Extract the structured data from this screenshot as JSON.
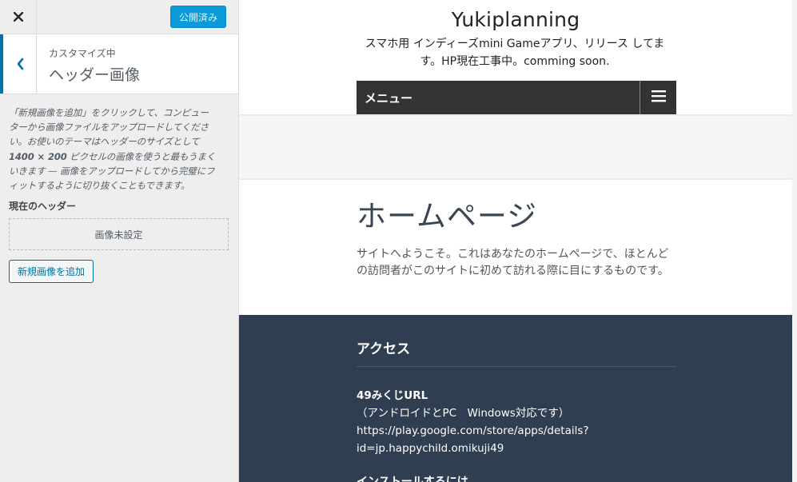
{
  "sidebar": {
    "close_icon": "close-icon",
    "publish_label": "公開済み",
    "back_icon": "chevron-left-icon",
    "section_sub": "カスタマイズ中",
    "section_title": "ヘッダー画像",
    "description": {
      "line1": "「新規画像を追加」をクリックして、コンピュー",
      "line2": "ターから画像ファイルをアップロードしてくださ",
      "line3": "い。お使いのテーマはヘッダーのサイズとして",
      "line4_size": "1400 × 200",
      "line4_rest": " ピクセルの画像を使うと最もうまく",
      "line5": "いきます — 画像をアップロードしてから完璧にフ",
      "line6": "ィットするように切り抜くこともできます。"
    },
    "current_header_label": "現在のヘッダー",
    "no_image_label": "画像未設定",
    "add_new_label": "新規画像を追加"
  },
  "preview": {
    "site_title": "Yukiplanning",
    "site_description": "スマホ用 インディーズmini Gameアプリ、リリース してます。HP現在工事中。comming soon.",
    "menu_label": "メニュー",
    "menu_icon": "hamburger-icon",
    "page_heading": "ホームページ",
    "page_body": "サイトへようこそ。これはあなたのホームページで、ほとんどの訪問者がこのサイトに初めて訪れる際に目にするものです。",
    "footer": {
      "heading": "アクセス",
      "line1": "49みくじURL",
      "line2": "（アンドロイドとPC　Windows対応です）",
      "line3": "https://play.google.com/store/apps/details?",
      "line4": "id=jp.happychild.omikuji49",
      "line5_partial": "インストールするには"
    }
  },
  "colors": {
    "publish_button": "#0a9ad8",
    "accent_border": "#0073aa",
    "menu_bar": "#333333",
    "footer_bg": "#2f3e50"
  }
}
